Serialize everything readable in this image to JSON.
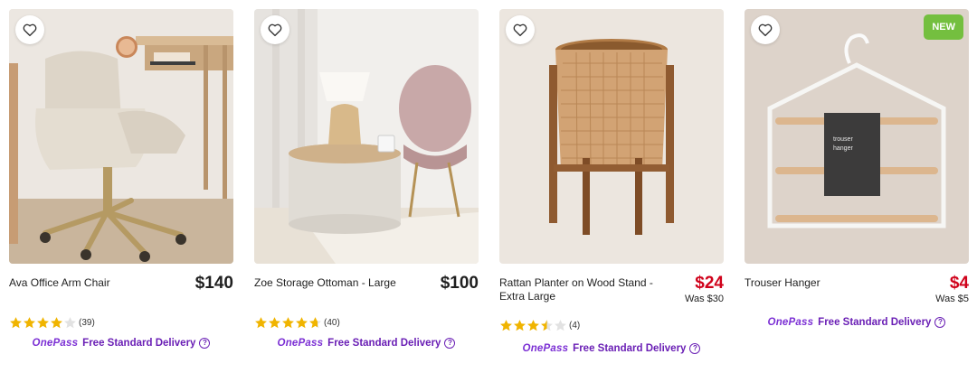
{
  "colors": {
    "sale_price": "#d0021b",
    "onepass_purple": "#7b2fd4",
    "new_badge": "#74bf3f",
    "star_gold": "#f0b400"
  },
  "products": [
    {
      "name": "Ava Office Arm Chair",
      "price": "$140",
      "was": "",
      "rating": 4.0,
      "count": "(39)",
      "badge": "",
      "onepass": "OnePass",
      "delivery": "Free Standard Delivery"
    },
    {
      "name": "Zoe Storage Ottoman - Large",
      "price": "$100",
      "was": "",
      "rating": 4.7,
      "count": "(40)",
      "badge": "",
      "onepass": "OnePass",
      "delivery": "Free Standard Delivery"
    },
    {
      "name": "Rattan Planter on Wood Stand - Extra Large",
      "price": "$24",
      "was": "Was $30",
      "rating": 3.5,
      "count": "(4)",
      "badge": "",
      "onepass": "OnePass",
      "delivery": "Free Standard Delivery"
    },
    {
      "name": "Trouser Hanger",
      "price": "$4",
      "was": "Was $5",
      "rating": null,
      "count": "",
      "badge": "NEW",
      "onepass": "OnePass",
      "delivery": "Free Standard Delivery"
    }
  ],
  "packaging": {
    "line1": "trouser",
    "line2": "hanger"
  }
}
